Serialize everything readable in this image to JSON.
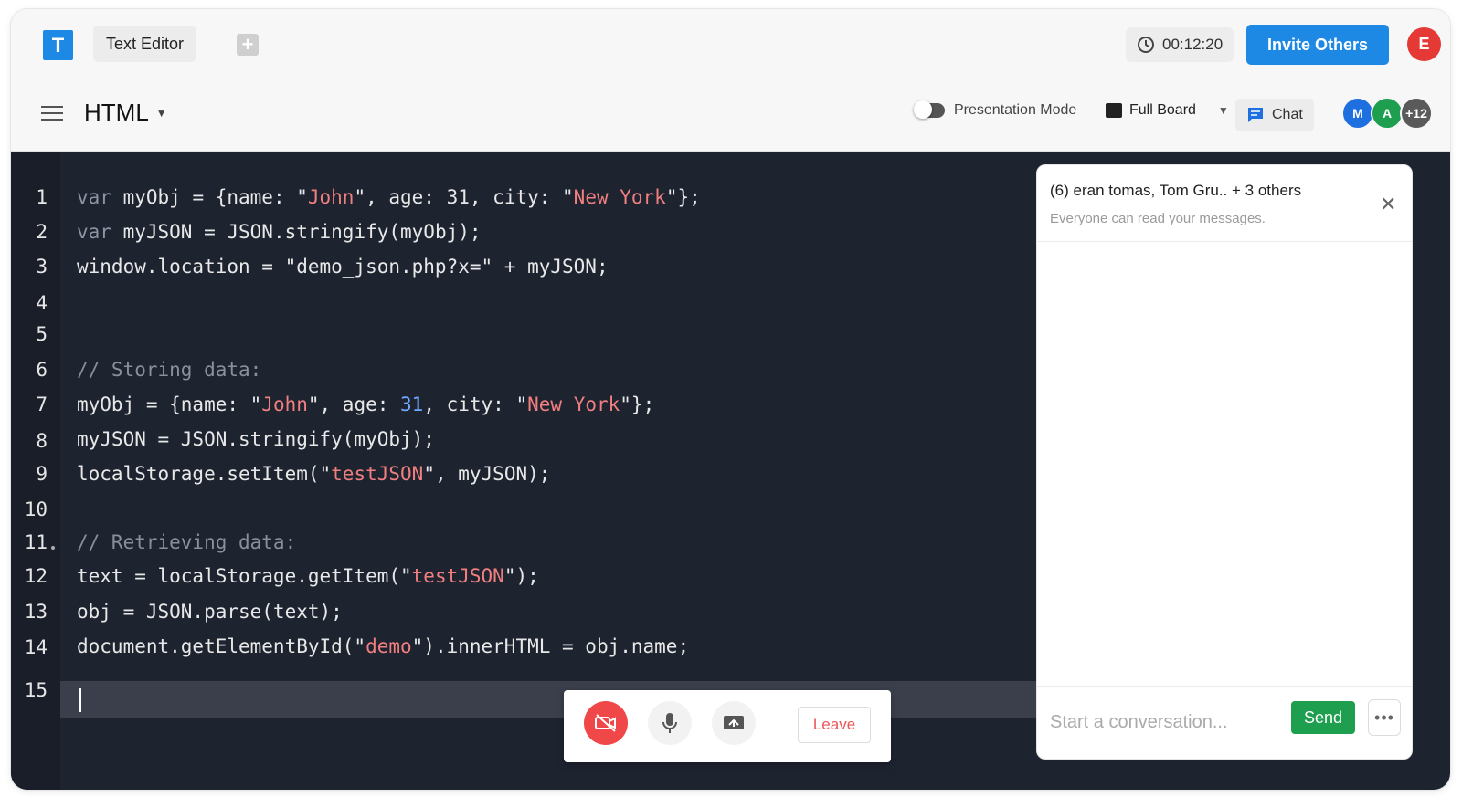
{
  "app": {
    "logo_letter": "T",
    "document_tab": "Text Editor"
  },
  "header": {
    "timer": "00:12:20",
    "invite_label": "Invite Others",
    "user_initial": "E"
  },
  "toolbar": {
    "language": "HTML",
    "presentation_label": "Presentation Mode",
    "board_label": "Full Board",
    "chat_label": "Chat",
    "avatars": [
      {
        "initial": "M",
        "color": "#1e6fe0"
      },
      {
        "initial": "A",
        "color": "#1e9e4f"
      },
      {
        "initial": "+12",
        "color": "#5a5a5a"
      }
    ]
  },
  "editor": {
    "line_numbers": [
      "1",
      "2",
      "3",
      "4",
      "5",
      "6",
      "7",
      "8",
      "9",
      "10",
      "11",
      "12",
      "13",
      "14",
      "15"
    ]
  },
  "chat": {
    "title": "(6) eran tomas, Tom Gru.. + 3 others",
    "subtitle": "Everyone can read your messages.",
    "input_placeholder": "Start a conversation...",
    "send_label": "Send"
  },
  "call": {
    "leave_label": "Leave"
  },
  "colors": {
    "accent": "#1e88e5",
    "danger": "#f04848",
    "success": "#1e9e4f"
  }
}
